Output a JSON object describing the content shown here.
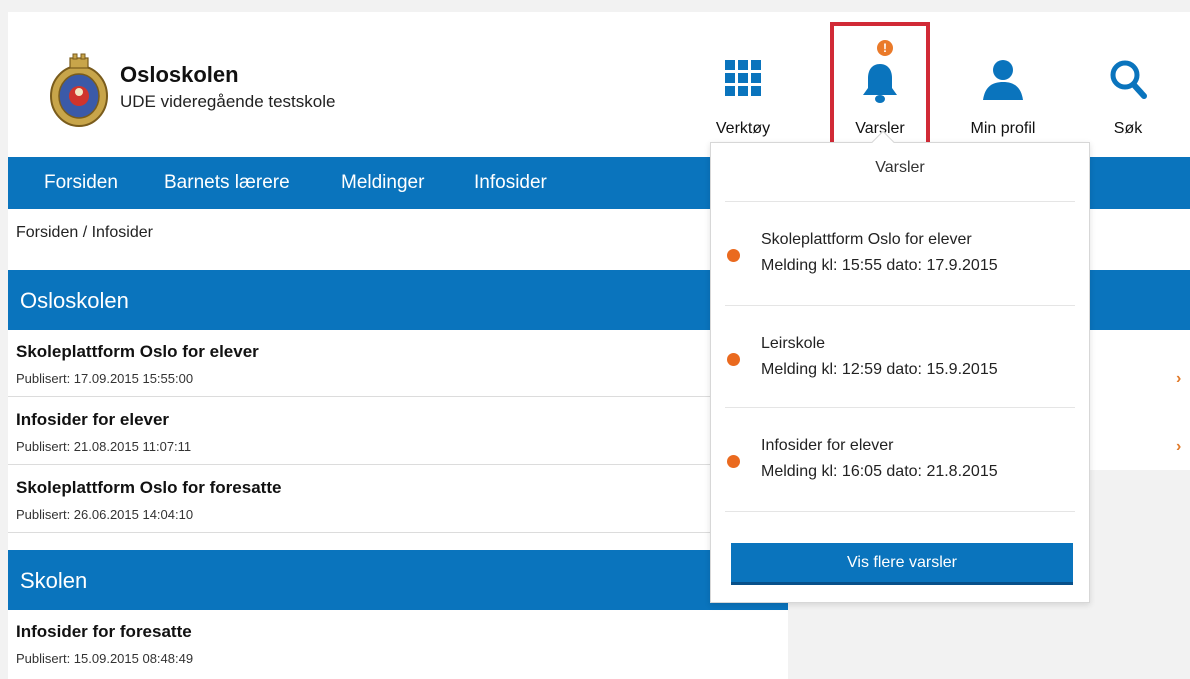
{
  "header": {
    "org_title": "Osloskolen",
    "org_subtitle": "UDE videregående testskole",
    "tools": {
      "verktoy": "Verktøy",
      "varsler": "Varsler",
      "profil": "Min profil",
      "sok": "Søk",
      "alert_badge": "!"
    }
  },
  "nav": {
    "items": [
      "Forsiden",
      "Barnets lærere",
      "Meldinger",
      "Infosider"
    ]
  },
  "breadcrumb": "Forsiden / Infosider",
  "sections": [
    {
      "title": "Osloskolen",
      "articles": [
        {
          "title": "Skoleplattform Oslo for elever",
          "published": "Publisert: 17.09.2015 15:55:00"
        },
        {
          "title": "Infosider for elever",
          "published": "Publisert: 21.08.2015 11:07:11"
        },
        {
          "title": "Skoleplattform Oslo for foresatte",
          "published": "Publisert: 26.06.2015 14:04:10"
        }
      ]
    },
    {
      "title": "Skolen",
      "articles": [
        {
          "title": "Infosider for foresatte",
          "published": "Publisert: 15.09.2015 08:48:49"
        }
      ]
    }
  ],
  "notifications": {
    "title": "Varsler",
    "items": [
      {
        "title": "Skoleplattform Oslo for elever",
        "meta": "Melding kl: 15:55 dato: 17.9.2015"
      },
      {
        "title": "Leirskole",
        "meta": "Melding kl: 12:59 dato: 15.9.2015"
      },
      {
        "title": "Infosider for elever",
        "meta": "Melding kl: 16:05 dato: 21.8.2015"
      }
    ],
    "more_button": "Vis flere varsler"
  },
  "colors": {
    "primary_blue": "#0a74bd",
    "highlight_red": "#d12a36",
    "notification_orange": "#ea6a1f"
  },
  "icons": {
    "logo": "oslo-city-seal-logo",
    "verktoy": "grid-icon",
    "varsler": "bell-icon",
    "profil": "user-icon",
    "sok": "search-icon"
  }
}
